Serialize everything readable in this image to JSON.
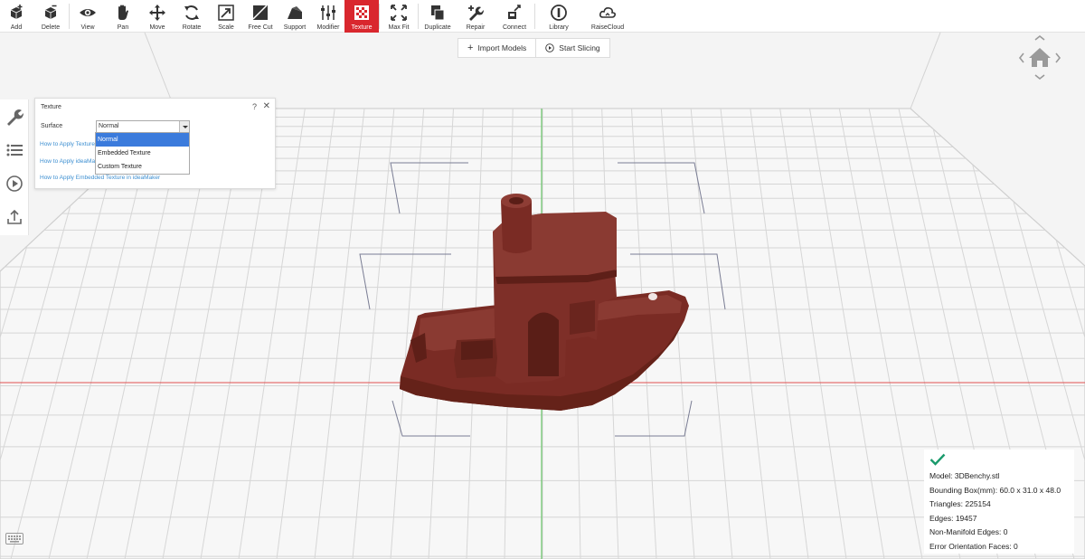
{
  "toolbar": {
    "items": [
      {
        "label": "Add",
        "icon": "add-cube-icon"
      },
      {
        "label": "Delete",
        "icon": "delete-cube-icon"
      },
      {
        "label": "View",
        "icon": "eye-icon"
      },
      {
        "label": "Pan",
        "icon": "hand-icon"
      },
      {
        "label": "Move",
        "icon": "move-arrows-icon"
      },
      {
        "label": "Rotate",
        "icon": "rotate-icon"
      },
      {
        "label": "Scale",
        "icon": "scale-icon"
      },
      {
        "label": "Free Cut",
        "icon": "free-cut-icon"
      },
      {
        "label": "Support",
        "icon": "support-icon"
      },
      {
        "label": "Modifier",
        "icon": "sliders-icon"
      },
      {
        "label": "Texture",
        "icon": "checker-icon"
      },
      {
        "label": "Max Fit",
        "icon": "max-fit-icon"
      },
      {
        "label": "Duplicate",
        "icon": "duplicate-icon"
      },
      {
        "label": "Repair",
        "icon": "wrench-plus-icon"
      },
      {
        "label": "Connect",
        "icon": "connect-icon"
      },
      {
        "label": "Library",
        "icon": "library-icon"
      },
      {
        "label": "RaiseCloud",
        "icon": "cloud-icon"
      }
    ],
    "active": "Texture",
    "accent": "#d9272e"
  },
  "actions": {
    "import_label": "Import Models",
    "slice_label": "Start Slicing"
  },
  "texture_panel": {
    "title": "Texture",
    "help": "?",
    "close": "✕",
    "surface_label": "Surface",
    "surface_value": "Normal",
    "options": [
      "Normal",
      "Embedded Texture",
      "Custom Texture"
    ],
    "links": [
      "How to Apply Texture",
      "How to Apply ideaMaker",
      "How to Apply Embedded Texture in ideaMaker"
    ]
  },
  "model_info": {
    "model": "Model: 3DBenchy.stl",
    "bbox": "Bounding Box(mm): 60.0 x 31.0 x 48.0",
    "triangles": "Triangles: 225154",
    "edges": "Edges: 19457",
    "non_manifold": "Non-Manifold Edges: 0",
    "error_faces": "Error Orientation Faces: 0",
    "status_color": "#1a9a6c"
  },
  "colors": {
    "model": "#7a2b24",
    "x_axis": "#e05050",
    "y_axis": "#4fbf4f"
  }
}
